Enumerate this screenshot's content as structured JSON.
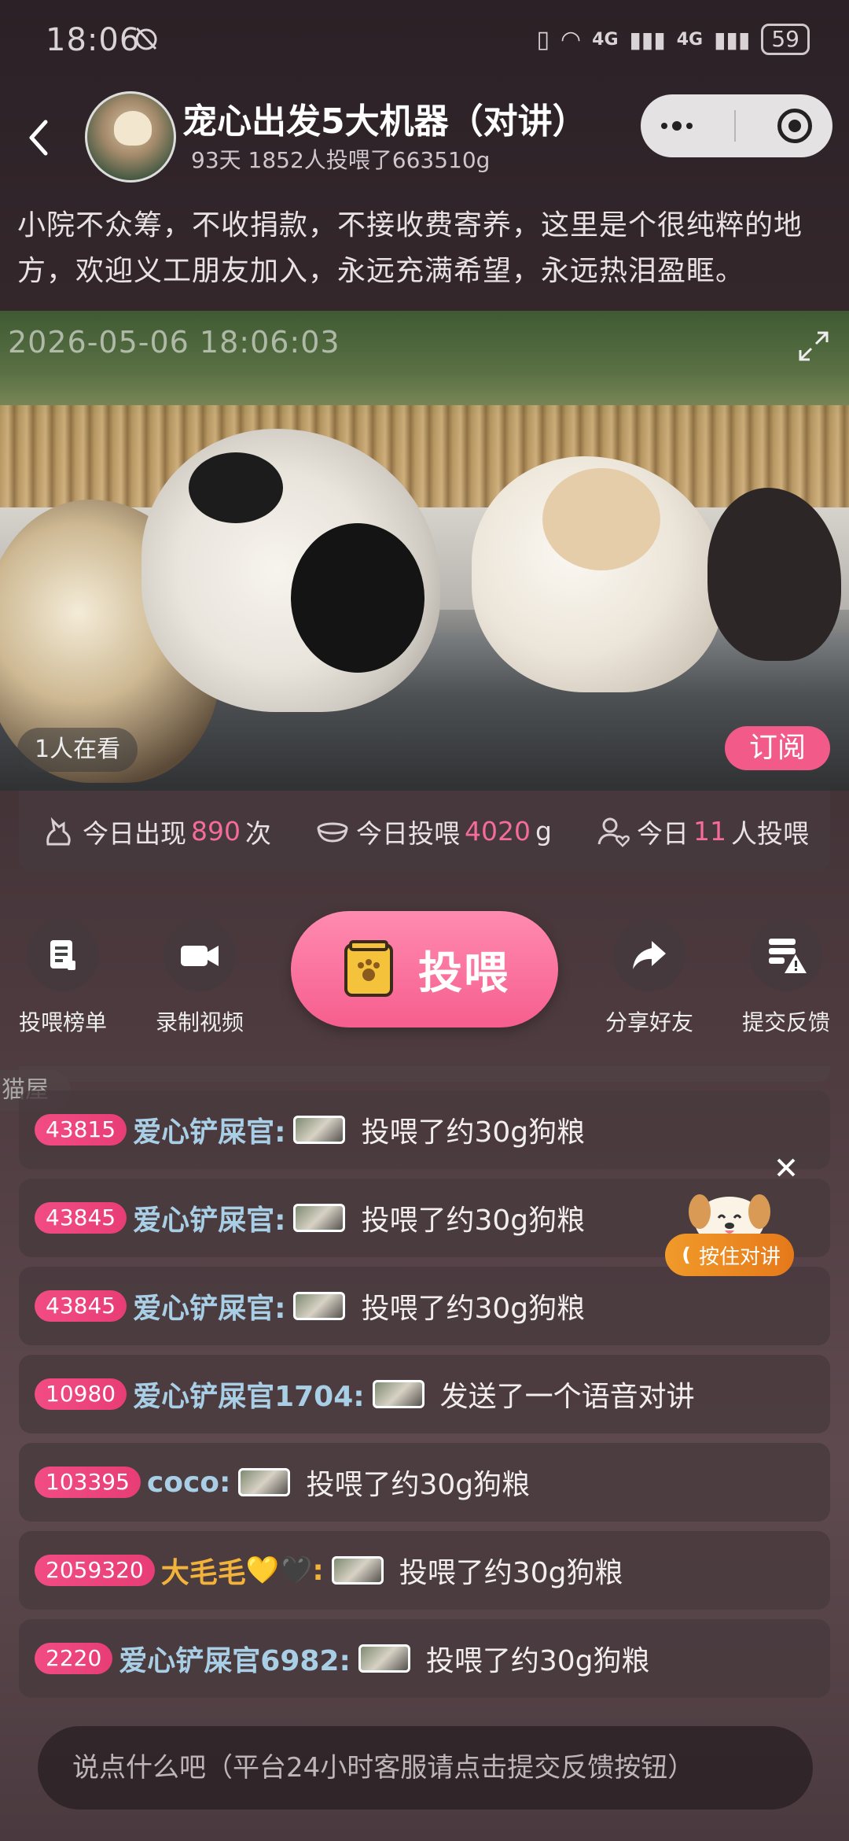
{
  "status_bar": {
    "time": "18:06",
    "signal_1": "4G",
    "signal_2": "4G",
    "battery": "59"
  },
  "header": {
    "title": "宠心出发5大机器（对讲）",
    "subtitle": "93天  1852人投喂了663510g"
  },
  "description": "小院不众筹，不收捐款，不接收费寄养，这里是个很纯粹的地方，欢迎义工朋友加入，永远充满希望，永远热泪盈眶。",
  "video": {
    "timestamp": "2026-05-06 18:06:03",
    "viewers": "1人在看",
    "subscribe_label": "订阅"
  },
  "stats": [
    {
      "prefix": "今日出现",
      "value": "890",
      "suffix": "次",
      "icon": "cat-icon"
    },
    {
      "prefix": "今日投喂",
      "value": "4020",
      "suffix": "g",
      "icon": "bowl-icon"
    },
    {
      "prefix": "今日",
      "value": "11",
      "suffix": "人投喂",
      "icon": "user-heart-icon"
    }
  ],
  "actions": {
    "leaderboard": "投喂榜单",
    "record": "录制视频",
    "feed": "投喂",
    "share": "分享好友",
    "feedback": "提交反馈"
  },
  "ghost_tag": "猫屋",
  "chat": [
    {
      "badge": "43815",
      "name": "爱心铲屎官:",
      "message": "投喂了约30g狗粮"
    },
    {
      "badge": "43845",
      "name": "爱心铲屎官:",
      "message": "投喂了约30g狗粮"
    },
    {
      "badge": "43845",
      "name": "爱心铲屎官:",
      "message": "投喂了约30g狗粮"
    },
    {
      "badge": "10980",
      "name": "爱心铲屎官1704:",
      "message": "发送了一个语音对讲"
    },
    {
      "badge": "103395",
      "name": "coco:",
      "message": "投喂了约30g狗粮"
    },
    {
      "badge": "2059320",
      "name": "大毛毛",
      "emoji": "💛🖤",
      "colon": ":",
      "message": "投喂了约30g狗粮"
    },
    {
      "badge": "2220",
      "name": "爱心铲屎官6982:",
      "message": "投喂了约30g狗粮"
    }
  ],
  "talk_widget": {
    "label": "按住对讲"
  },
  "input": {
    "placeholder": "说点什么吧（平台24小时客服请点击提交反馈按钮）"
  },
  "colors": {
    "accent_pink": "#f56b9a",
    "feed_button": "#f65e8e",
    "username": "#a9cfe6",
    "gold_user": "#f3b33a",
    "talk_orange": "#e6791a"
  }
}
